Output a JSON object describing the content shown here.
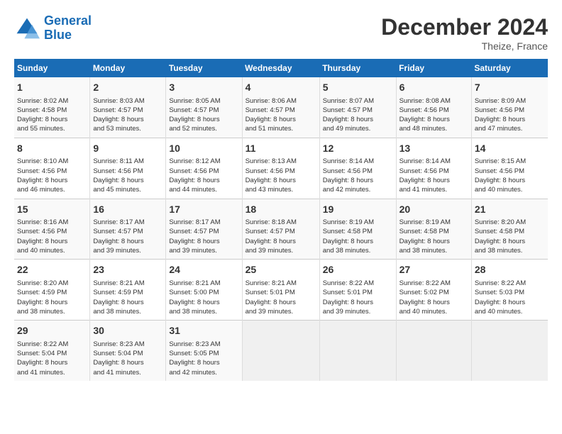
{
  "header": {
    "logo_line1": "General",
    "logo_line2": "Blue",
    "month": "December 2024",
    "location": "Theize, France"
  },
  "days_of_week": [
    "Sunday",
    "Monday",
    "Tuesday",
    "Wednesday",
    "Thursday",
    "Friday",
    "Saturday"
  ],
  "weeks": [
    [
      {
        "day": "1",
        "info": "Sunrise: 8:02 AM\nSunset: 4:58 PM\nDaylight: 8 hours\nand 55 minutes."
      },
      {
        "day": "2",
        "info": "Sunrise: 8:03 AM\nSunset: 4:57 PM\nDaylight: 8 hours\nand 53 minutes."
      },
      {
        "day": "3",
        "info": "Sunrise: 8:05 AM\nSunset: 4:57 PM\nDaylight: 8 hours\nand 52 minutes."
      },
      {
        "day": "4",
        "info": "Sunrise: 8:06 AM\nSunset: 4:57 PM\nDaylight: 8 hours\nand 51 minutes."
      },
      {
        "day": "5",
        "info": "Sunrise: 8:07 AM\nSunset: 4:57 PM\nDaylight: 8 hours\nand 49 minutes."
      },
      {
        "day": "6",
        "info": "Sunrise: 8:08 AM\nSunset: 4:56 PM\nDaylight: 8 hours\nand 48 minutes."
      },
      {
        "day": "7",
        "info": "Sunrise: 8:09 AM\nSunset: 4:56 PM\nDaylight: 8 hours\nand 47 minutes."
      }
    ],
    [
      {
        "day": "8",
        "info": "Sunrise: 8:10 AM\nSunset: 4:56 PM\nDaylight: 8 hours\nand 46 minutes."
      },
      {
        "day": "9",
        "info": "Sunrise: 8:11 AM\nSunset: 4:56 PM\nDaylight: 8 hours\nand 45 minutes."
      },
      {
        "day": "10",
        "info": "Sunrise: 8:12 AM\nSunset: 4:56 PM\nDaylight: 8 hours\nand 44 minutes."
      },
      {
        "day": "11",
        "info": "Sunrise: 8:13 AM\nSunset: 4:56 PM\nDaylight: 8 hours\nand 43 minutes."
      },
      {
        "day": "12",
        "info": "Sunrise: 8:14 AM\nSunset: 4:56 PM\nDaylight: 8 hours\nand 42 minutes."
      },
      {
        "day": "13",
        "info": "Sunrise: 8:14 AM\nSunset: 4:56 PM\nDaylight: 8 hours\nand 41 minutes."
      },
      {
        "day": "14",
        "info": "Sunrise: 8:15 AM\nSunset: 4:56 PM\nDaylight: 8 hours\nand 40 minutes."
      }
    ],
    [
      {
        "day": "15",
        "info": "Sunrise: 8:16 AM\nSunset: 4:56 PM\nDaylight: 8 hours\nand 40 minutes."
      },
      {
        "day": "16",
        "info": "Sunrise: 8:17 AM\nSunset: 4:57 PM\nDaylight: 8 hours\nand 39 minutes."
      },
      {
        "day": "17",
        "info": "Sunrise: 8:17 AM\nSunset: 4:57 PM\nDaylight: 8 hours\nand 39 minutes."
      },
      {
        "day": "18",
        "info": "Sunrise: 8:18 AM\nSunset: 4:57 PM\nDaylight: 8 hours\nand 39 minutes."
      },
      {
        "day": "19",
        "info": "Sunrise: 8:19 AM\nSunset: 4:58 PM\nDaylight: 8 hours\nand 38 minutes."
      },
      {
        "day": "20",
        "info": "Sunrise: 8:19 AM\nSunset: 4:58 PM\nDaylight: 8 hours\nand 38 minutes."
      },
      {
        "day": "21",
        "info": "Sunrise: 8:20 AM\nSunset: 4:58 PM\nDaylight: 8 hours\nand 38 minutes."
      }
    ],
    [
      {
        "day": "22",
        "info": "Sunrise: 8:20 AM\nSunset: 4:59 PM\nDaylight: 8 hours\nand 38 minutes."
      },
      {
        "day": "23",
        "info": "Sunrise: 8:21 AM\nSunset: 4:59 PM\nDaylight: 8 hours\nand 38 minutes."
      },
      {
        "day": "24",
        "info": "Sunrise: 8:21 AM\nSunset: 5:00 PM\nDaylight: 8 hours\nand 38 minutes."
      },
      {
        "day": "25",
        "info": "Sunrise: 8:21 AM\nSunset: 5:01 PM\nDaylight: 8 hours\nand 39 minutes."
      },
      {
        "day": "26",
        "info": "Sunrise: 8:22 AM\nSunset: 5:01 PM\nDaylight: 8 hours\nand 39 minutes."
      },
      {
        "day": "27",
        "info": "Sunrise: 8:22 AM\nSunset: 5:02 PM\nDaylight: 8 hours\nand 40 minutes."
      },
      {
        "day": "28",
        "info": "Sunrise: 8:22 AM\nSunset: 5:03 PM\nDaylight: 8 hours\nand 40 minutes."
      }
    ],
    [
      {
        "day": "29",
        "info": "Sunrise: 8:22 AM\nSunset: 5:04 PM\nDaylight: 8 hours\nand 41 minutes."
      },
      {
        "day": "30",
        "info": "Sunrise: 8:23 AM\nSunset: 5:04 PM\nDaylight: 8 hours\nand 41 minutes."
      },
      {
        "day": "31",
        "info": "Sunrise: 8:23 AM\nSunset: 5:05 PM\nDaylight: 8 hours\nand 42 minutes."
      },
      null,
      null,
      null,
      null
    ]
  ]
}
